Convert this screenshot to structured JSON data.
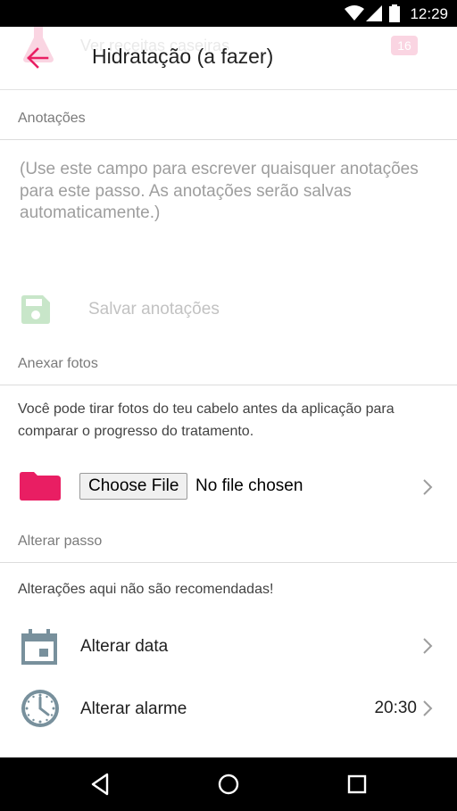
{
  "status_bar": {
    "time": "12:29",
    "icons": [
      "wifi-icon",
      "cell-signal-icon",
      "battery-icon"
    ]
  },
  "app_bar": {
    "title": "Hidratação (a fazer)",
    "back_icon": "arrow-back-icon",
    "underlay_text": "Ver receitas caseiras",
    "underlay_badge": "16"
  },
  "notes": {
    "header": "Anotações",
    "placeholder": "(Use este campo para escrever quaisquer anotações para este passo. As anotações serão salvas automaticamente.)",
    "save_label": "Salvar anotações",
    "save_icon": "floppy-disk-icon"
  },
  "photos": {
    "header": "Anexar fotos",
    "description": "Você pode tirar fotos do teu cabelo antes da aplicação para comparar o progresso do tratamento.",
    "choose_file_label": "Choose File",
    "no_file_text": "No file chosen",
    "folder_icon": "folder-icon"
  },
  "change_step": {
    "header": "Alterar passo",
    "warning": "Alterações aqui não são recomendadas!",
    "items": [
      {
        "label": "Alterar data",
        "icon": "calendar-icon",
        "value": ""
      },
      {
        "label": "Alterar alarme",
        "icon": "clock-icon",
        "value": "20:30"
      }
    ]
  },
  "nav_bar": {
    "icons": [
      "nav-back-icon",
      "nav-home-icon",
      "nav-recents-icon"
    ]
  },
  "colors": {
    "accent": "#e91e63",
    "save_icon": "#c8e6c9",
    "section_text": "#7a7a7a",
    "icon_grey": "#78909c"
  }
}
